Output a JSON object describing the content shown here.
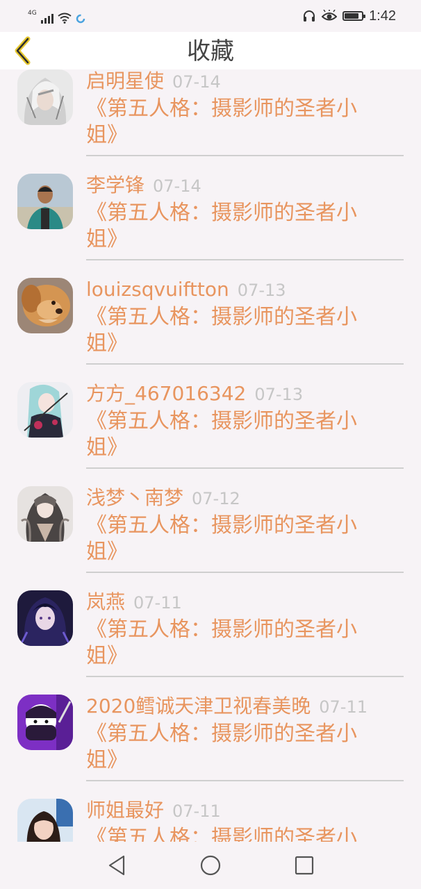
{
  "status_bar": {
    "network": "4G",
    "time": "1:42",
    "battery_level": 0.85,
    "icons": [
      "signal-icon",
      "wifi-icon",
      "loading-icon",
      "headphones-icon",
      "eye-icon",
      "battery-icon"
    ]
  },
  "header": {
    "title": "收藏",
    "back_icon": "chevron-left-icon"
  },
  "colors": {
    "accent": "#e8955f",
    "back_arrow": "#e6c72e",
    "date": "#c6c6c6",
    "divider": "#cfcfcf",
    "background": "#f7f3f6"
  },
  "favorites": [
    {
      "user": "启明星使",
      "date": "07-14",
      "post": "《第五人格：摄影师的圣者小姐》",
      "avatar": "anime-white-hair-avatar"
    },
    {
      "user": "李学锋",
      "date": "07-14",
      "post": "《第五人格：摄影师的圣者小姐》",
      "avatar": "boy-photo-avatar"
    },
    {
      "user": "louizsqvuiftton",
      "date": "07-13",
      "post": "《第五人格：摄影师的圣者小姐》",
      "avatar": "puppy-avatar"
    },
    {
      "user": "方方_467016342",
      "date": "07-13",
      "post": "《第五人格：摄影师的圣者小姐》",
      "avatar": "anime-girl-teal-avatar"
    },
    {
      "user": "浅梦丶南梦",
      "date": "07-12",
      "post": "《第五人格：摄影师的圣者小姐》",
      "avatar": "anime-girl-dark-avatar"
    },
    {
      "user": "岚燕",
      "date": "07-11",
      "post": "《第五人格：摄影师的圣者小姐》",
      "avatar": "anime-girl-purple-avatar"
    },
    {
      "user": "2020鳕诚天津卫视春美晚",
      "date": "07-11",
      "post": "《第五人格：摄影师的圣者小姐》",
      "avatar": "cartoon-ninja-avatar"
    },
    {
      "user": "师姐最好",
      "date": "07-11",
      "post": "《第五人格：摄影师的圣者小姐》",
      "avatar": "woman-photo-avatar"
    }
  ],
  "nav_bar": {
    "icons": [
      "nav-back-icon",
      "nav-home-icon",
      "nav-recents-icon"
    ]
  }
}
